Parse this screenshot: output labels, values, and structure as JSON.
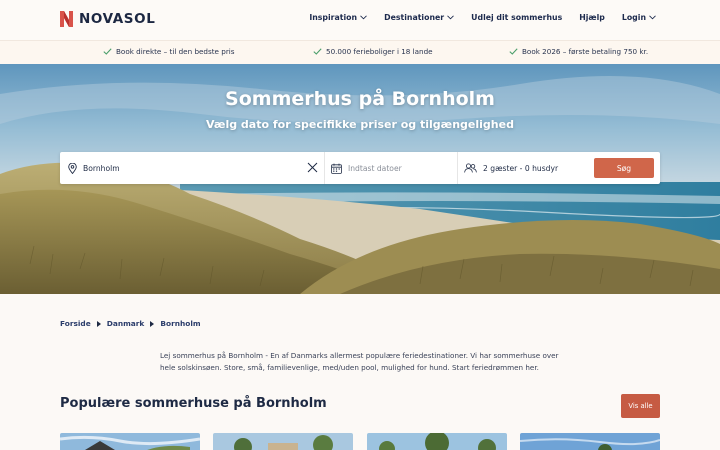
{
  "header": {
    "logo_text": "NOVASOL",
    "nav": [
      {
        "label": "Inspiration",
        "has_dropdown": true
      },
      {
        "label": "Destinationer",
        "has_dropdown": true
      },
      {
        "label": "Udlej dit sommerhus",
        "has_dropdown": false
      },
      {
        "label": "Hjælp",
        "has_dropdown": false
      },
      {
        "label": "Login",
        "has_dropdown": true
      }
    ]
  },
  "usp": [
    "Book direkte – til den bedste pris",
    "50.000 ferieboliger i 18 lande",
    "Book 2026 – første betaling 750 kr."
  ],
  "hero": {
    "title": "Sommerhus på Bornholm",
    "subtitle": "Vælg dato for specifikke priser og tilgængelighed"
  },
  "search": {
    "destination_value": "Bornholm",
    "dates_placeholder": "Indtast datoer",
    "guests_value": "2 gæster - 0 husdyr",
    "button_label": "Søg"
  },
  "breadcrumb": [
    "Forside",
    "Danmark",
    "Bornholm"
  ],
  "intro_text": "Lej sommerhus på Bornholm - En af Danmarks allermest populære feriedestinationer. Vi har sommerhuse over hele solskinsøen. Store, små, familievenlige, med/uden pool, mulighed for hund. Start feriedrømmen her.",
  "popular": {
    "title": "Populære sommerhuse på Bornholm",
    "button_label": "Vis alle"
  },
  "colors": {
    "brand_red": "#d0664a",
    "navy": "#1e2a44",
    "usp_check": "#4a9e6a"
  }
}
